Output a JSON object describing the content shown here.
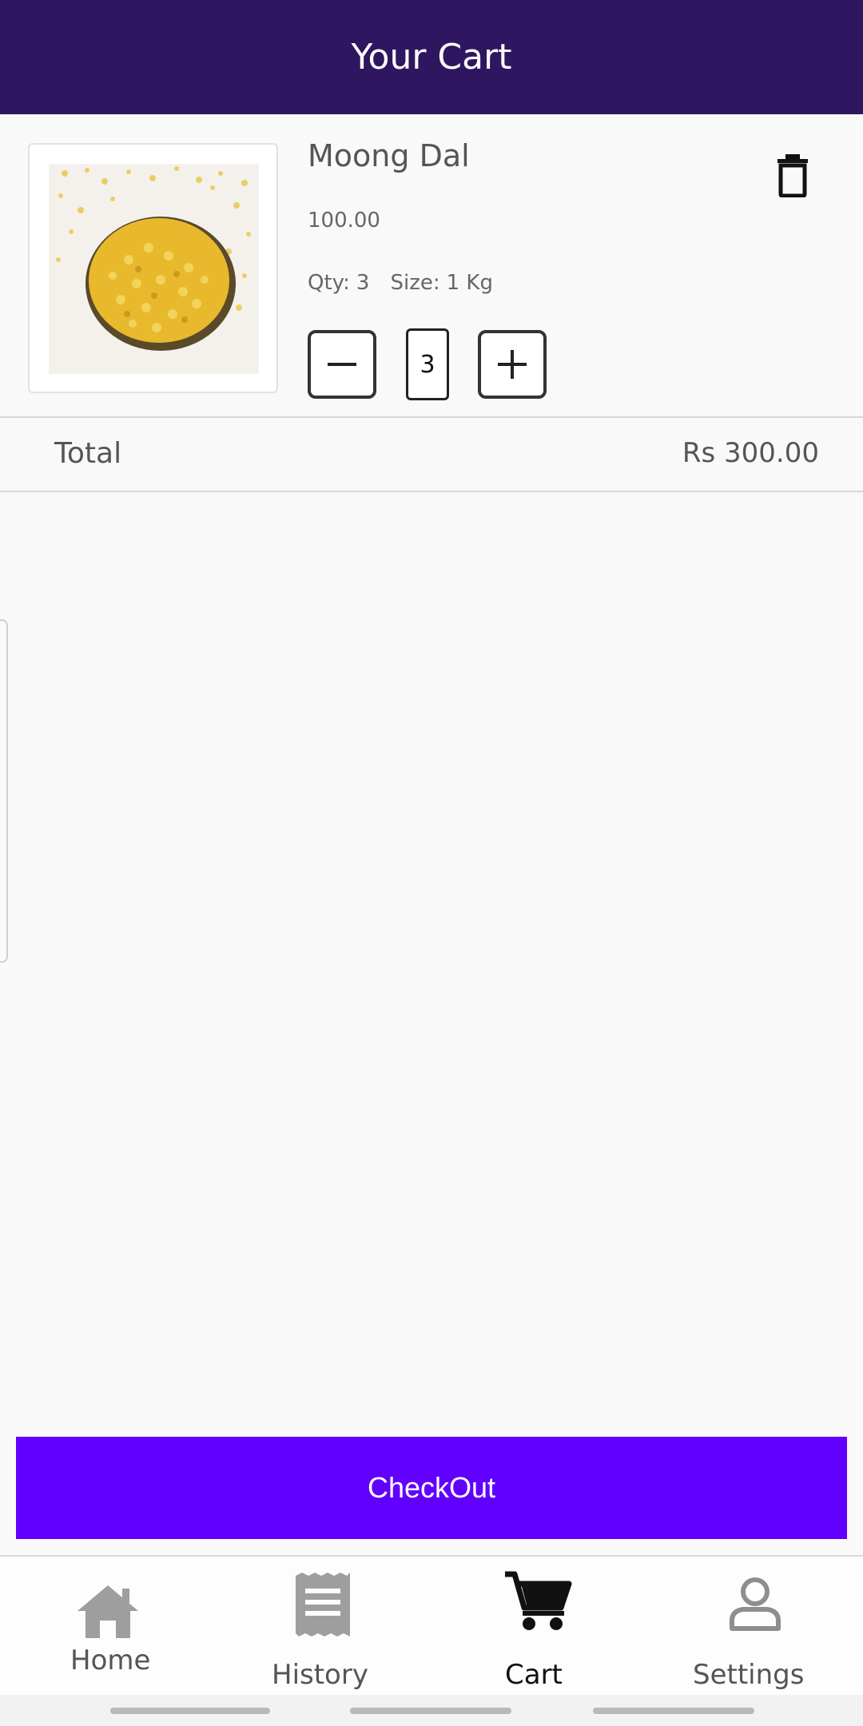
{
  "theme": {
    "header_bg": "#2e1660",
    "accent": "#6200ff",
    "active_nav": "#111111",
    "inactive_nav": "#9e9e9e"
  },
  "header": {
    "title": "Your Cart"
  },
  "cart": {
    "items": [
      {
        "name": "Moong Dal",
        "price": "100.00",
        "qty_label": "Qty:",
        "qty_value": "3",
        "size_label": "Size:",
        "size_value": "1 Kg",
        "stepper_value": "3",
        "image_icon": "moong-dal-photo",
        "delete_icon": "trash-icon"
      }
    ],
    "total_label": "Total",
    "total_value": "Rs 300.00"
  },
  "checkout": {
    "label": "CheckOut"
  },
  "bottom_nav": {
    "items": [
      {
        "label": "Home",
        "icon": "home-icon",
        "active": false
      },
      {
        "label": "History",
        "icon": "receipt-icon",
        "active": false
      },
      {
        "label": "Cart",
        "icon": "cart-icon",
        "active": true
      },
      {
        "label": "Settings",
        "icon": "person-icon",
        "active": false
      }
    ]
  }
}
